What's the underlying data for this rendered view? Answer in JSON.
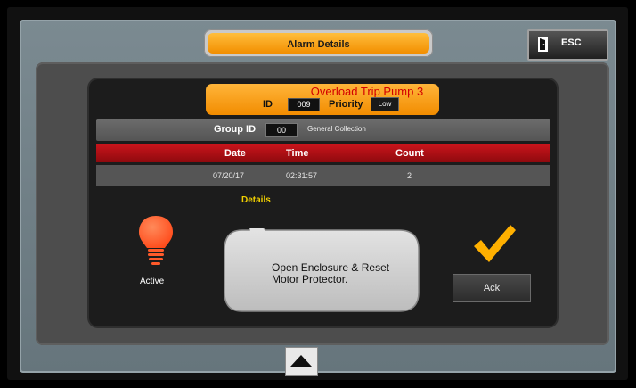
{
  "header": {
    "title": "Alarm Details",
    "esc_label": "ESC"
  },
  "alarm": {
    "name": "Overload Trip Pump 3",
    "id_label": "ID",
    "id_value": "009",
    "priority_label": "Priority",
    "priority_value": "Low"
  },
  "group": {
    "label": "Group ID",
    "value": "00",
    "name": "General Collection"
  },
  "table": {
    "columns": [
      "Date",
      "Time",
      "Count"
    ],
    "rows": [
      [
        "07/20/17",
        "02:31:57",
        "2"
      ]
    ]
  },
  "details": {
    "label": "Details",
    "text": "Open Enclosure & Reset\nMotor Protector."
  },
  "status": {
    "label": "Active",
    "icon": "lightbulb-icon",
    "color": "#ff5a2a"
  },
  "ack": {
    "label": "Ack",
    "icon": "checkmark-icon",
    "color": "#ffb000"
  },
  "nav": {
    "up_icon": "arrow-up-icon"
  }
}
